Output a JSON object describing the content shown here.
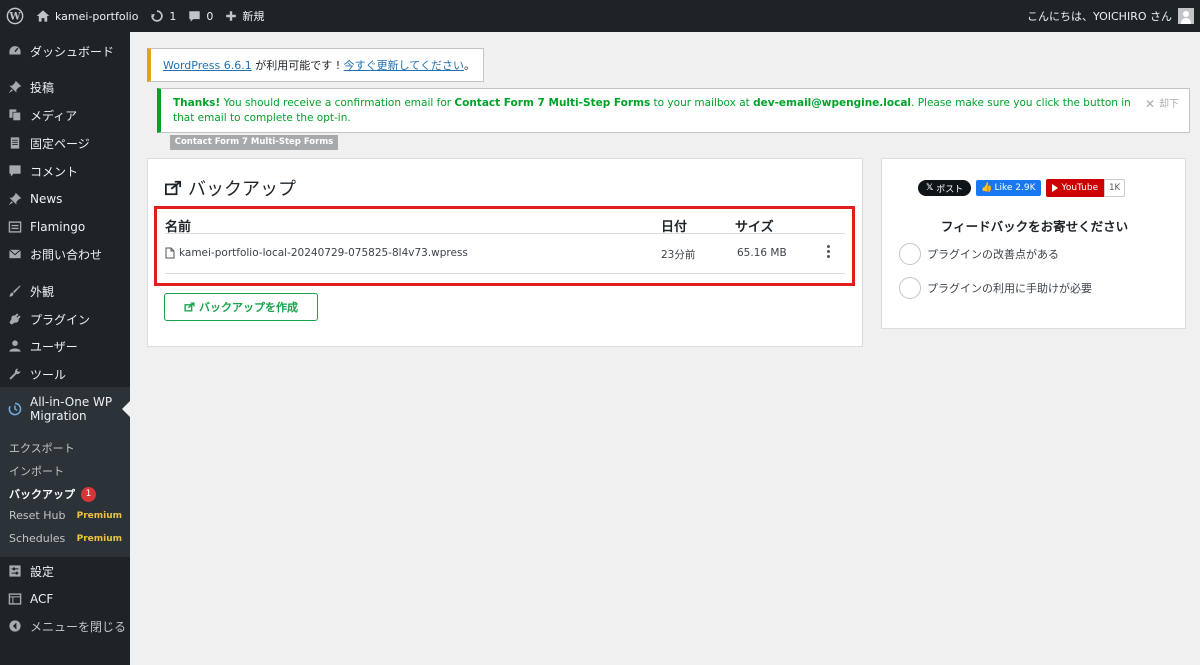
{
  "admin_bar": {
    "site_name": "kamei-portfolio",
    "updates_count": "1",
    "comments_count": "0",
    "new_label": "新規",
    "greeting": "こんにちは、YOICHIRO さん"
  },
  "sidebar": {
    "items": [
      {
        "label": "ダッシュボード",
        "icon": "dashboard-icon"
      },
      {
        "label": "投稿",
        "icon": "pin-icon"
      },
      {
        "label": "メディア",
        "icon": "media-icon"
      },
      {
        "label": "固定ページ",
        "icon": "page-icon"
      },
      {
        "label": "コメント",
        "icon": "comment-icon"
      },
      {
        "label": "News",
        "icon": "pin-icon"
      },
      {
        "label": "Flamingo",
        "icon": "flamingo-icon"
      },
      {
        "label": "お問い合わせ",
        "icon": "mail-icon"
      },
      {
        "label": "外観",
        "icon": "brush-icon"
      },
      {
        "label": "プラグイン",
        "icon": "plugin-icon"
      },
      {
        "label": "ユーザー",
        "icon": "user-icon"
      },
      {
        "label": "ツール",
        "icon": "wrench-icon"
      },
      {
        "label": "All-in-One WP Migration",
        "icon": "migration-icon"
      },
      {
        "label": "設定",
        "icon": "settings-icon"
      },
      {
        "label": "ACF",
        "icon": "acf-icon"
      },
      {
        "label": "メニューを閉じる",
        "icon": "collapse-icon"
      }
    ],
    "submenu": [
      {
        "label": "エクスポート",
        "tag": ""
      },
      {
        "label": "インポート",
        "tag": ""
      },
      {
        "label": "バックアップ",
        "badge": "1"
      },
      {
        "label": "Reset Hub",
        "tag": "Premium"
      },
      {
        "label": "Schedules",
        "tag": "Premium"
      }
    ]
  },
  "notices": {
    "update": {
      "version_link": "WordPress 6.6.1",
      "middle": " が利用可能です ! ",
      "update_link": "今すぐ更新してください",
      "end": "。"
    },
    "thanks": {
      "bold1": "Thanks!",
      "t1": " You should receive a confirmation email for ",
      "bold2": "Contact Form 7 Multi-Step Forms",
      "t2": " to your mailbox at ",
      "bold3": "dev-email@wpengine.local",
      "t3": ". Please make sure you click the button in that email to complete the opt-in.",
      "dismiss": "却下"
    },
    "tag": "Contact Form 7 Multi-Step Forms"
  },
  "backup": {
    "title": "バックアップ",
    "columns": {
      "name": "名前",
      "date": "日付",
      "size": "サイズ"
    },
    "rows": [
      {
        "name": "kamei-portfolio-local-20240729-075825-8l4v73.wpress",
        "date": "23分前",
        "size": "65.16 MB"
      }
    ],
    "create_button": "バックアップを作成"
  },
  "feedback": {
    "x_post": "ポスト",
    "fb_like": "Like 2.9K",
    "youtube": "YouTube",
    "youtube_count": "1K",
    "title": "フィードバックをお寄せください",
    "options": [
      "プラグインの改善点がある",
      "プラグインの利用に手助けが必要"
    ]
  },
  "colors": {
    "admin_bg": "#1d2327",
    "accent": "#2271b1",
    "highlight_border": "#e01e1e",
    "success": "#17a34a",
    "warning": "#dba617",
    "premium": "#f0c33c"
  }
}
